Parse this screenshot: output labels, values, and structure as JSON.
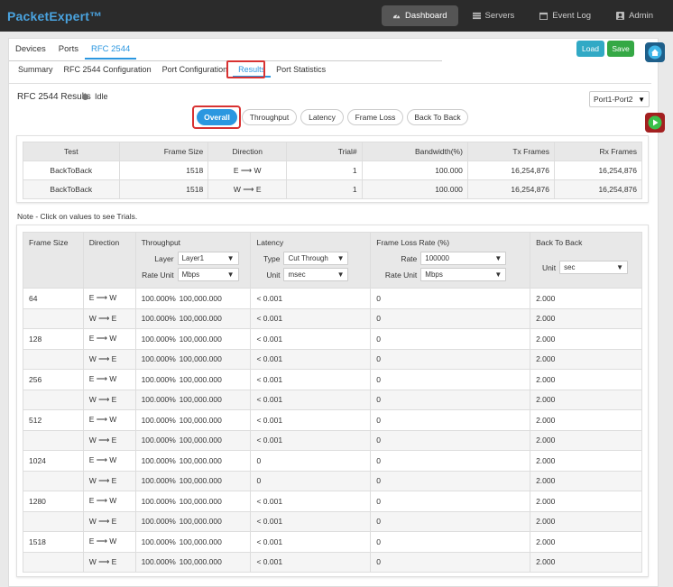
{
  "app": {
    "brand": "PacketExpert™"
  },
  "topnav": [
    {
      "label": "Dashboard",
      "icon": "dashboard-icon"
    },
    {
      "label": "Servers",
      "icon": "servers-icon"
    },
    {
      "label": "Event Log",
      "icon": "calendar-icon"
    },
    {
      "label": "Admin",
      "icon": "user-icon"
    }
  ],
  "tabs1": [
    "Devices",
    "Ports",
    "RFC 2544"
  ],
  "actions": {
    "load": "Load",
    "save": "Save"
  },
  "tabs2": [
    "Summary",
    "RFC 2544 Configuration",
    "Port Configuration",
    "Results",
    "Port Statistics"
  ],
  "results": {
    "title": "RFC 2544 Results",
    "status": "Idle",
    "port": "Port1-Port2"
  },
  "views": [
    "Overall",
    "Throughput",
    "Latency",
    "Frame Loss",
    "Back To Back"
  ],
  "summary": {
    "headers": [
      "Test",
      "Frame Size",
      "Direction",
      "Trial#",
      "Bandwidth(%)",
      "Tx Frames",
      "Rx Frames"
    ],
    "rows": [
      [
        "BackToBack",
        "1518",
        "E ⟶ W",
        "1",
        "100.000",
        "16,254,876",
        "16,254,876"
      ],
      [
        "BackToBack",
        "1518",
        "W ⟶ E",
        "1",
        "100.000",
        "16,254,876",
        "16,254,876"
      ]
    ]
  },
  "note": "Note - Click on values to see Trials.",
  "detail": {
    "headers": {
      "frame_size": "Frame Size",
      "direction": "Direction",
      "throughput": "Throughput",
      "latency": "Latency",
      "frame_loss": "Frame Loss Rate (%)",
      "back_to_back": "Back To Back"
    },
    "controls": {
      "layer_label": "Layer",
      "layer_value": "Layer1",
      "tp_rate_unit_label": "Rate Unit",
      "tp_rate_unit_value": "Mbps",
      "type_label": "Type",
      "type_value": "Cut Through",
      "lat_unit_label": "Unit",
      "lat_unit_value": "msec",
      "rate_label": "Rate",
      "rate_value": "100000",
      "fl_rate_unit_label": "Rate Unit",
      "fl_rate_unit_value": "Mbps",
      "b2b_unit_label": "Unit",
      "b2b_unit_value": "sec"
    },
    "rows": [
      {
        "size": "64",
        "dir": "E ⟶ W",
        "tp": "100.000%",
        "tpr": "100,000.000",
        "lat": "< 0.001",
        "fl": "0",
        "b2b": "2.000"
      },
      {
        "size": "",
        "dir": "W ⟶ E",
        "tp": "100.000%",
        "tpr": "100,000.000",
        "lat": "< 0.001",
        "fl": "0",
        "b2b": "2.000"
      },
      {
        "size": "128",
        "dir": "E ⟶ W",
        "tp": "100.000%",
        "tpr": "100,000.000",
        "lat": "< 0.001",
        "fl": "0",
        "b2b": "2.000"
      },
      {
        "size": "",
        "dir": "W ⟶ E",
        "tp": "100.000%",
        "tpr": "100,000.000",
        "lat": "< 0.001",
        "fl": "0",
        "b2b": "2.000"
      },
      {
        "size": "256",
        "dir": "E ⟶ W",
        "tp": "100.000%",
        "tpr": "100,000.000",
        "lat": "< 0.001",
        "fl": "0",
        "b2b": "2.000"
      },
      {
        "size": "",
        "dir": "W ⟶ E",
        "tp": "100.000%",
        "tpr": "100,000.000",
        "lat": "< 0.001",
        "fl": "0",
        "b2b": "2.000"
      },
      {
        "size": "512",
        "dir": "E ⟶ W",
        "tp": "100.000%",
        "tpr": "100,000.000",
        "lat": "< 0.001",
        "fl": "0",
        "b2b": "2.000"
      },
      {
        "size": "",
        "dir": "W ⟶ E",
        "tp": "100.000%",
        "tpr": "100,000.000",
        "lat": "< 0.001",
        "fl": "0",
        "b2b": "2.000"
      },
      {
        "size": "1024",
        "dir": "E ⟶ W",
        "tp": "100.000%",
        "tpr": "100,000.000",
        "lat": "0",
        "fl": "0",
        "b2b": "2.000"
      },
      {
        "size": "",
        "dir": "W ⟶ E",
        "tp": "100.000%",
        "tpr": "100,000.000",
        "lat": "0",
        "fl": "0",
        "b2b": "2.000"
      },
      {
        "size": "1280",
        "dir": "E ⟶ W",
        "tp": "100.000%",
        "tpr": "100,000.000",
        "lat": "< 0.001",
        "fl": "0",
        "b2b": "2.000"
      },
      {
        "size": "",
        "dir": "W ⟶ E",
        "tp": "100.000%",
        "tpr": "100,000.000",
        "lat": "< 0.001",
        "fl": "0",
        "b2b": "2.000"
      },
      {
        "size": "1518",
        "dir": "E ⟶ W",
        "tp": "100.000%",
        "tpr": "100,000.000",
        "lat": "< 0.001",
        "fl": "0",
        "b2b": "2.000"
      },
      {
        "size": "",
        "dir": "W ⟶ E",
        "tp": "100.000%",
        "tpr": "100,000.000",
        "lat": "< 0.001",
        "fl": "0",
        "b2b": "2.000"
      }
    ]
  }
}
